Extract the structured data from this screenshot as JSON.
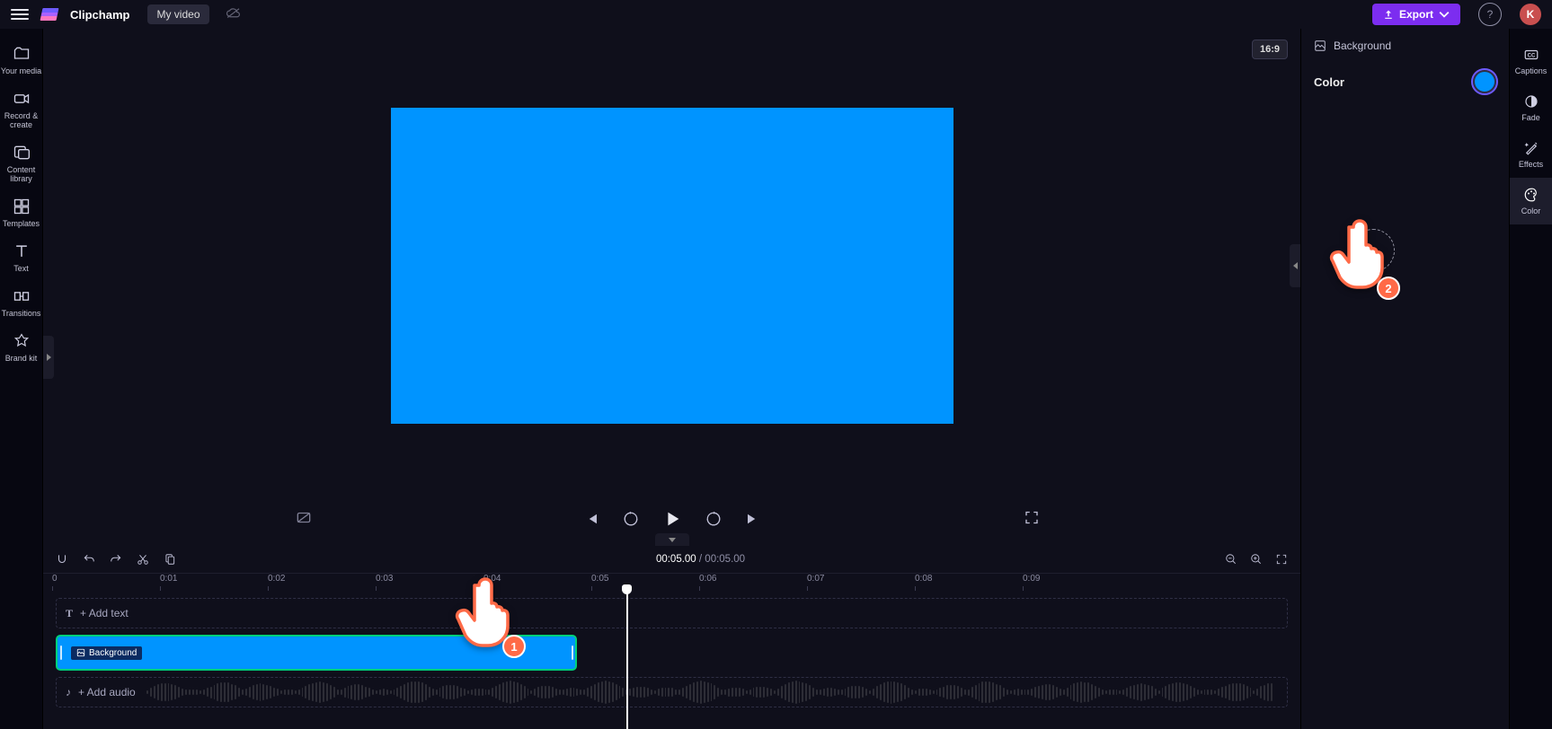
{
  "app": {
    "brand": "Clipchamp",
    "project": "My video",
    "avatar_initial": "K"
  },
  "header": {
    "export_label": "Export"
  },
  "left_rail": {
    "items": [
      {
        "label": "Your media"
      },
      {
        "label": "Record & create"
      },
      {
        "label": "Content library"
      },
      {
        "label": "Templates"
      },
      {
        "label": "Text"
      },
      {
        "label": "Transitions"
      },
      {
        "label": "Brand kit"
      }
    ]
  },
  "preview": {
    "aspect": "16:9",
    "canvas_color": "#0094ff"
  },
  "transport": {
    "current_time": "00:05.00",
    "duration": "00:05.00"
  },
  "ruler": {
    "ticks": [
      "0",
      "0:01",
      "0:02",
      "0:03",
      "0:04",
      "0:05",
      "0:06",
      "0:07",
      "0:08",
      "0:09"
    ]
  },
  "tracks": {
    "text_hint": "+ Add text",
    "audio_hint": "+ Add audio",
    "clip_label": "Background"
  },
  "inspector": {
    "title": "Background",
    "color_label": "Color",
    "color_value": "#0094ff"
  },
  "right_rail": {
    "items": [
      {
        "label": "Captions"
      },
      {
        "label": "Fade"
      },
      {
        "label": "Effects"
      },
      {
        "label": "Color"
      }
    ]
  },
  "annotations": {
    "badge1": "1",
    "badge2": "2"
  }
}
